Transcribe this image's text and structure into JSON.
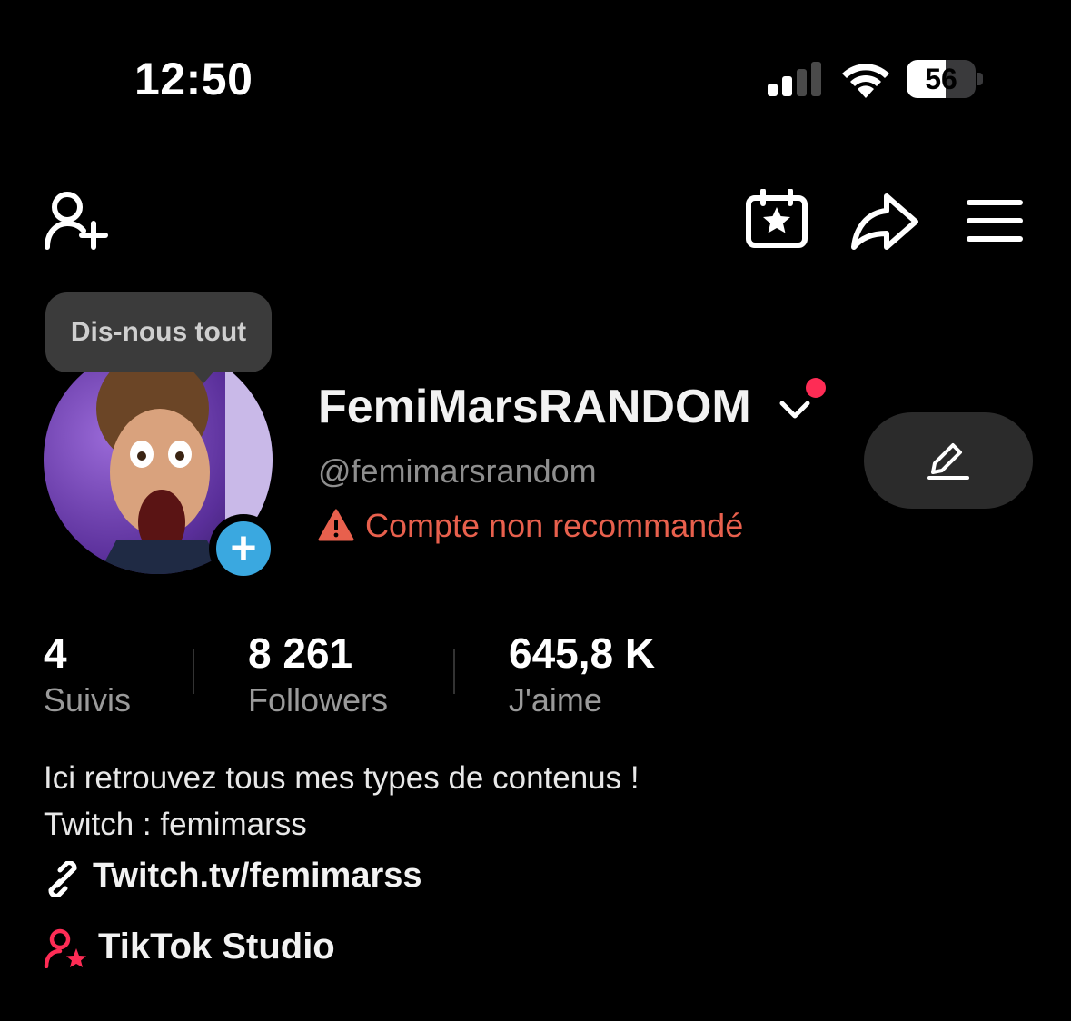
{
  "status_bar": {
    "time": "12:50",
    "battery_percent": "56",
    "battery_level": 0.56,
    "signal_bars_active": 2,
    "signal_bars_total": 4
  },
  "toolbar": {
    "icons": [
      "add-friend-icon",
      "calendar-star-icon",
      "share-icon",
      "menu-icon"
    ]
  },
  "tooltip": {
    "text": "Dis-nous tout"
  },
  "profile": {
    "display_name": "FemiMarsRANDOM",
    "handle": "@femimarsrandom",
    "warning": "Compte non recommandé"
  },
  "stats": [
    {
      "value": "4",
      "label": "Suivis"
    },
    {
      "value": "8 261",
      "label": "Followers"
    },
    {
      "value": "645,8 K",
      "label": "J'aime"
    }
  ],
  "bio": {
    "line1": "Ici retrouvez tous mes types de contenus !",
    "line2": "Twitch : femimarss",
    "link": "Twitch.tv/femimarss"
  },
  "studio": {
    "label": "TikTok Studio"
  },
  "colors": {
    "background": "#000000",
    "accent_red": "#fe2c55",
    "warning": "#e8604d",
    "add_blue": "#3aa8e0"
  }
}
